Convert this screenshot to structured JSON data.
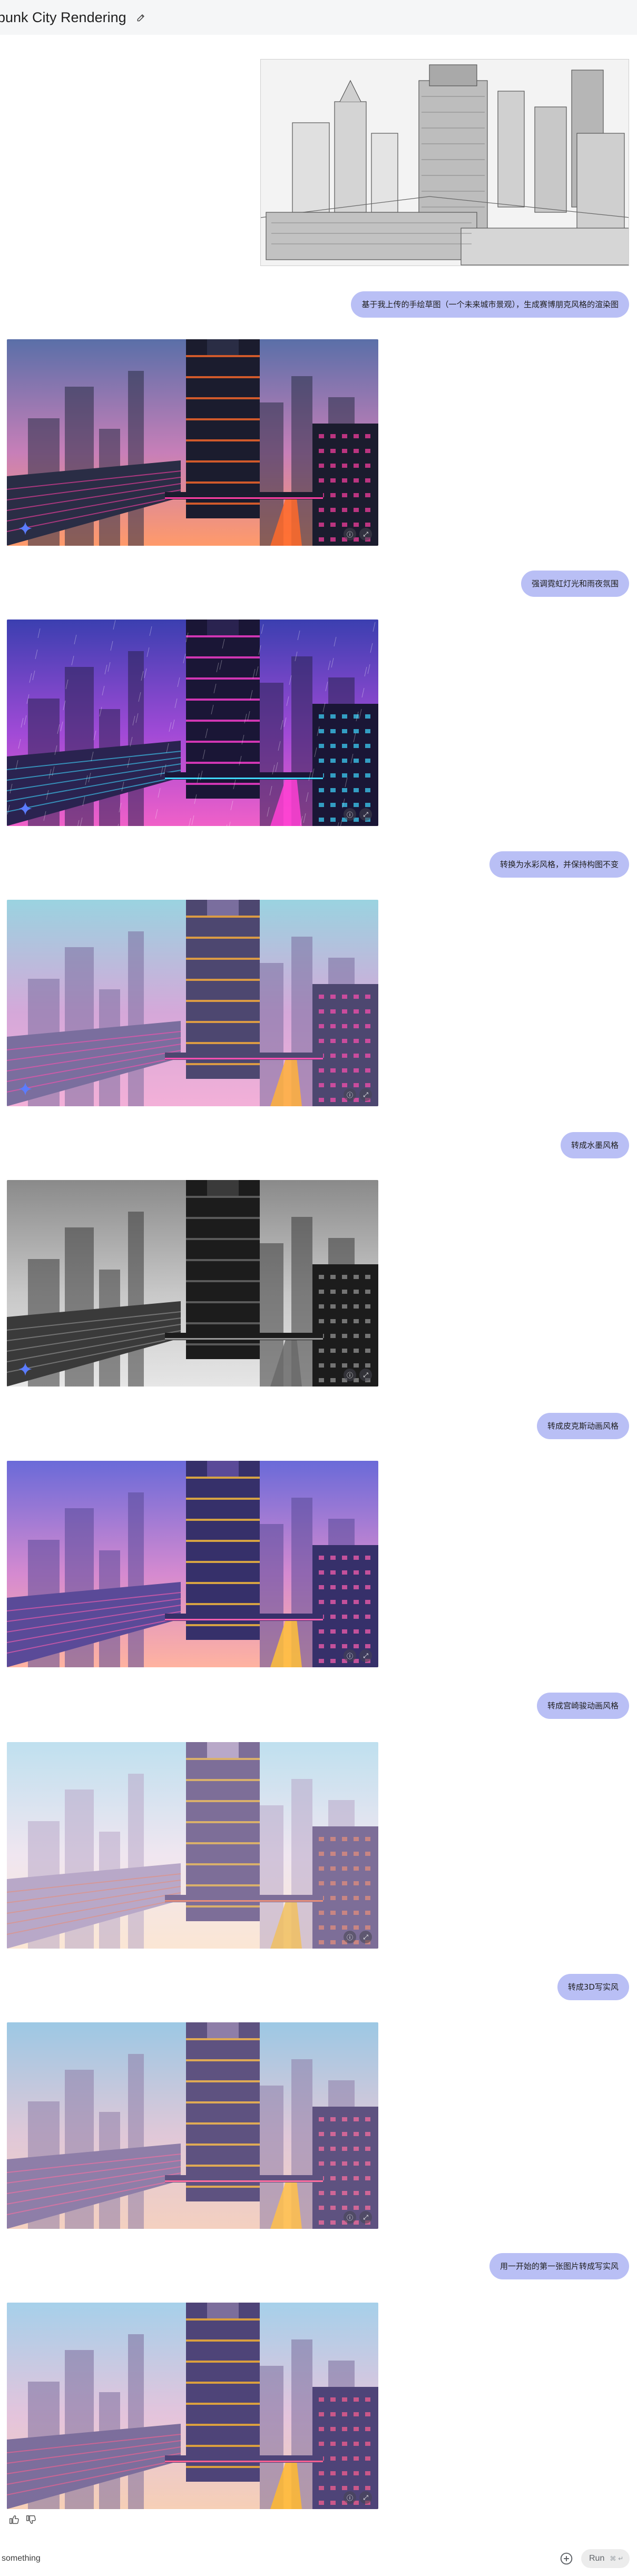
{
  "header": {
    "title": "rpunk City Rendering",
    "edit_icon": "pencil-icon"
  },
  "conversation": {
    "user_upload_icon": "sketch-image",
    "prompts": [
      "基于我上传的手绘草图（一个未来城市景观），生成赛博朋克风格的渲染图",
      "强调霓虹灯光和雨夜氛围",
      "转换为水彩风格，并保持构图不变",
      "转成水墨风格",
      "转成皮克斯动画风格",
      "转成宫崎骏动画风格",
      "转成3D写实风",
      "用一开始的第一张图片转成写实风"
    ],
    "image_buttons_icons": [
      "info-icon",
      "expand-icon"
    ]
  },
  "feedback": {
    "thumbs_up_icon": "thumbs-up-icon",
    "thumbs_down_icon": "thumbs-down-icon"
  },
  "composer": {
    "input_value": "something",
    "add_icon": "add-circle-icon",
    "run_label": "Run",
    "run_shortcut": "⌘ ↵"
  },
  "palettes": {
    "cyber": {
      "sky1": "#5a6fa8",
      "sky2": "#c77fb8",
      "sky3": "#ff9a6a",
      "bldg": "#2a2d45",
      "bldgDark": "#1b1c2e",
      "accent": "#ff6a2a",
      "accent2": "#ff3fa4"
    },
    "neon": {
      "sky1": "#3b3fb0",
      "sky2": "#a04ad6",
      "sky3": "#f060c8",
      "bldg": "#2a2350",
      "bldgDark": "#1a1636",
      "accent": "#ff3fd4",
      "accent2": "#3fd8ff"
    },
    "water": {
      "sky1": "#9ad3e0",
      "sky2": "#d5a8d9",
      "sky3": "#f3b0d8",
      "bldg": "#7a6e9e",
      "bldgDark": "#4d4770",
      "accent": "#ffb03a",
      "accent2": "#ff4fb0"
    },
    "ink": {
      "sky1": "#8a8a8a",
      "sky2": "#c8c8c8",
      "sky3": "#e6e6e6",
      "bldg": "#3a3a3a",
      "bldgDark": "#1c1c1c",
      "accent": "#6a6a6a",
      "accent2": "#9a9a9a"
    },
    "pixar": {
      "sky1": "#6a6ad8",
      "sky2": "#d58ad0",
      "sky3": "#ffb3a0",
      "bldg": "#5a4a98",
      "bldgDark": "#36306a",
      "accent": "#ffc03a",
      "accent2": "#ff5fb0"
    },
    "ghibli": {
      "sky1": "#bfe0ef",
      "sky2": "#f0e6f0",
      "sky3": "#fbe6d4",
      "bldg": "#b8a8c8",
      "bldgDark": "#7d6e98",
      "accent": "#f0c060",
      "accent2": "#e88f7a"
    },
    "real3d": {
      "sky1": "#9cc8e4",
      "sky2": "#e0c8d8",
      "sky3": "#f4d0c0",
      "bldg": "#8e7ea8",
      "bldgDark": "#5e5280",
      "accent": "#ffc04a",
      "accent2": "#ff6fa0"
    },
    "real": {
      "sky1": "#a6d0ea",
      "sky2": "#e4c4dc",
      "sky3": "#f6cfb6",
      "bldg": "#7c6e9c",
      "bldgDark": "#4e4478",
      "accent": "#ffb830",
      "accent2": "#ff6090"
    }
  }
}
